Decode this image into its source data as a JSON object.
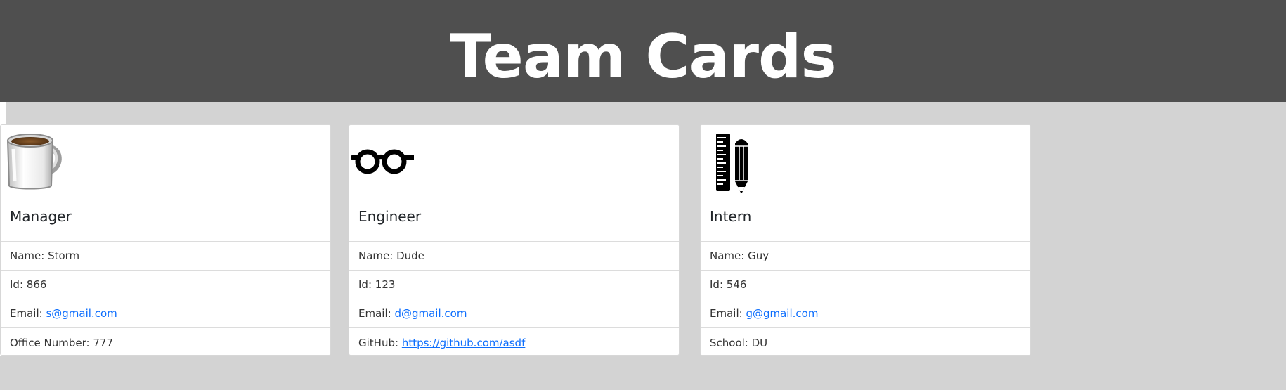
{
  "header": {
    "title": "Team Cards",
    "background": "#4f4f4f"
  },
  "cards": [
    {
      "icon": "coffee-mug-icon",
      "role": "Manager",
      "name_label": "Name: ",
      "name": "Storm",
      "id_label": "Id: ",
      "id": "866",
      "email_label": "Email: ",
      "email": "s@gmail.com",
      "extra_label": "Office Number: ",
      "extra_value": "777"
    },
    {
      "icon": "glasses-icon",
      "role": "Engineer",
      "name_label": "Name: ",
      "name": "Dude",
      "id_label": "Id: ",
      "id": "123",
      "email_label": "Email: ",
      "email": "d@gmail.com",
      "extra_label": "GitHub: ",
      "extra_value": "https://github.com/asdf"
    },
    {
      "icon": "ruler-pencil-icon",
      "role": "Intern",
      "name_label": "Name: ",
      "name": "Guy",
      "id_label": "Id: ",
      "id": "546",
      "email_label": "Email: ",
      "email": "g@gmail.com",
      "extra_label": "School: ",
      "extra_value": "DU"
    }
  ],
  "colors": {
    "page_background": "#d3d3d3",
    "link": "#0d6efd"
  }
}
